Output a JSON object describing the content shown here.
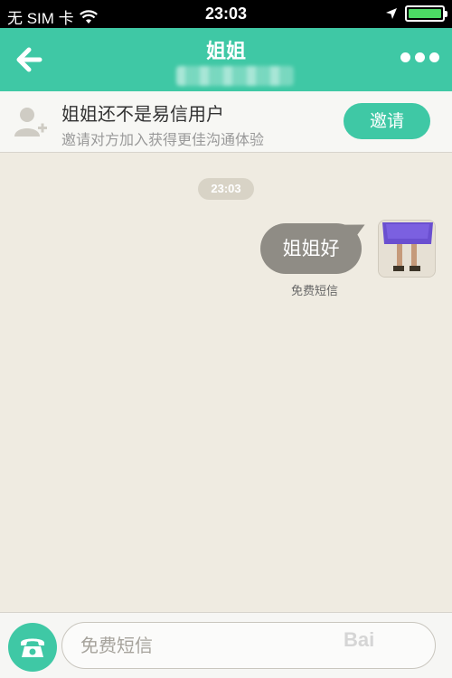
{
  "status_bar": {
    "carrier": "无 SIM 卡",
    "wifi_icon": "wifi-icon",
    "time": "23:03",
    "location_icon": "location-arrow-icon",
    "battery_level": 1.0,
    "battery_color": "#4cd964"
  },
  "nav": {
    "title": "姐姐",
    "back_icon": "back-arrow-icon",
    "more_icon": "more-dots-icon",
    "bg_color": "#3fc8a5"
  },
  "invite_banner": {
    "title": "姐姐还不是易信用户",
    "subtitle": "邀请对方加入获得更佳沟通体验",
    "button_label": "邀请",
    "avatar_icon": "add-contact-icon"
  },
  "chat": {
    "timestamp": "23:03",
    "messages": [
      {
        "text": "姐姐好",
        "type_label": "免费短信",
        "sender": "me"
      }
    ]
  },
  "composer": {
    "call_icon": "telephone-icon",
    "placeholder": "免费短信",
    "value": ""
  },
  "watermark": "Bai"
}
